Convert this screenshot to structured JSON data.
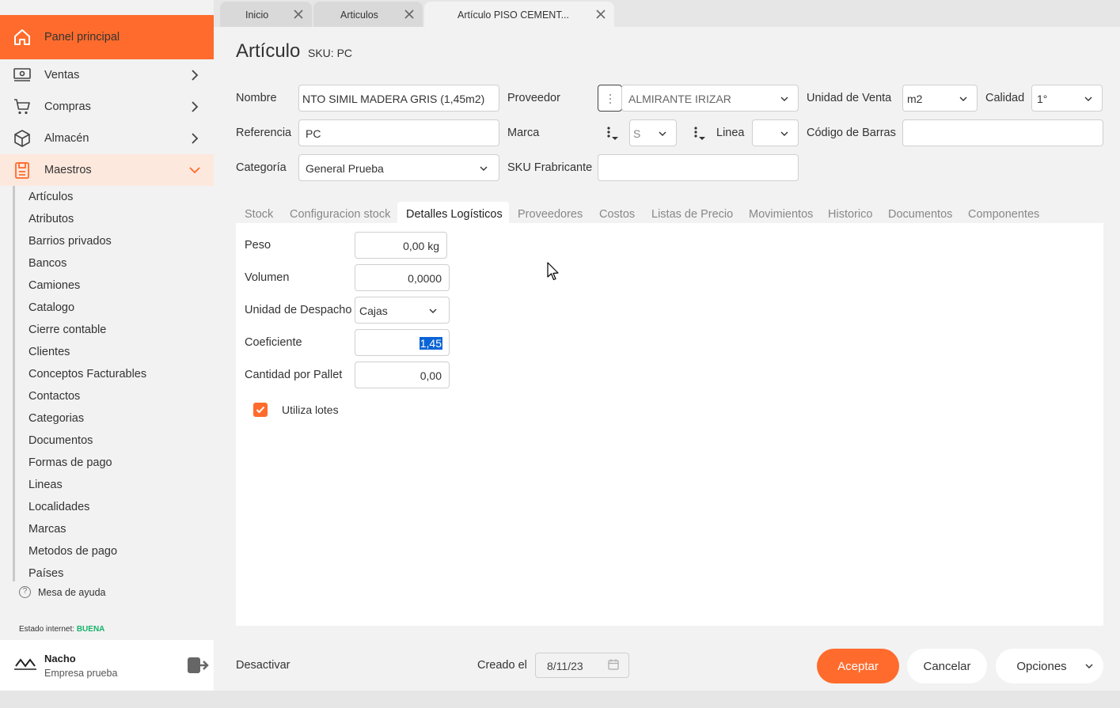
{
  "sidebar": {
    "panel_label": "Panel principal",
    "ventas_label": "Ventas",
    "compras_label": "Compras",
    "almacen_label": "Almacén",
    "maestros_label": "Maestros",
    "submenu": [
      "Artículos",
      "Atributos",
      "Barrios privados",
      "Bancos",
      "Camiones",
      "Catalogo",
      "Cierre contable",
      "Clientes",
      "Conceptos Facturables",
      "Contactos",
      "Categorias",
      "Documentos",
      "Formas de pago",
      "Lineas",
      "Localidades",
      "Marcas",
      "Metodos de pago",
      "Países"
    ],
    "help_label": "Mesa de ayuda",
    "internet_label": "Estado internet:",
    "internet_status": "BUENA",
    "user_name": "Nacho",
    "user_company": "Empresa prueba"
  },
  "tabs": [
    "Inicio",
    "Articulos",
    "Artículo PISO CEMENT..."
  ],
  "form": {
    "title": "Artículo",
    "sku_label": "SKU: PC",
    "nombre_label": "Nombre",
    "nombre_value": "NTO SIMIL MADERA GRIS (1,45m2)",
    "proveedor_label": "Proveedor",
    "proveedor_value": "ALMIRANTE IRIZAR",
    "unidad_venta_label": "Unidad de Venta",
    "unidad_venta_value": "m2",
    "calidad_label": "Calidad",
    "calidad_value": "1°",
    "referencia_label": "Referencia",
    "referencia_value": "PC",
    "marca_label": "Marca",
    "marca_value": "S",
    "linea_label": "Linea",
    "linea_value": "",
    "codigo_barras_label": "Código de Barras",
    "codigo_barras_value": "",
    "categoria_label": "Categoría",
    "categoria_value": "General Prueba",
    "sku_fabricante_label": "SKU Frabricante",
    "sku_fabricante_value": ""
  },
  "inner_tabs": [
    "Stock",
    "Configuracion stock",
    "Detalles Logísticos",
    "Proveedores",
    "Costos",
    "Listas de Precio",
    "Movimientos",
    "Historico",
    "Documentos",
    "Componentes"
  ],
  "logistics": {
    "peso_label": "Peso",
    "peso_value": "0,00 kg",
    "volumen_label": "Volumen",
    "volumen_value": "0,0000",
    "unidad_despacho_label": "Unidad de Despacho",
    "unidad_despacho_value": "Cajas",
    "coeficiente_label": "Coeficiente",
    "coeficiente_value": "1,45",
    "cantidad_pallet_label": "Cantidad por Pallet",
    "cantidad_pallet_value": "0,00",
    "utiliza_lotes_label": "Utiliza lotes",
    "utiliza_lotes_checked": true
  },
  "footer": {
    "desactivar_label": "Desactivar",
    "creado_label": "Creado el",
    "creado_value": "8/11/23",
    "aceptar_label": "Aceptar",
    "cancelar_label": "Cancelar",
    "opciones_label": "Opciones"
  },
  "colors": {
    "accent": "#ff6b2c",
    "status_good": "#17b26a",
    "selection": "#0a64d6"
  }
}
